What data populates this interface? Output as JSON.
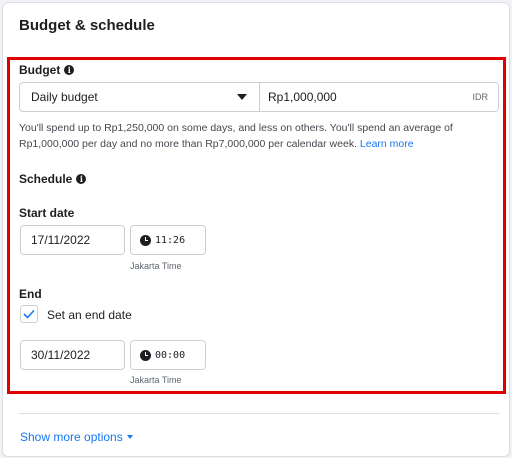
{
  "section": {
    "title": "Budget & schedule"
  },
  "budget": {
    "label": "Budget",
    "type_selected": "Daily budget",
    "amount": "Rp1,000,000",
    "currency": "IDR",
    "help_text": "You'll spend up to Rp1,250,000 on some days, and less on others. You'll spend an average of Rp1,000,000 per day and no more than Rp7,000,000 per calendar week.",
    "learn_more": "Learn more"
  },
  "schedule": {
    "label": "Schedule",
    "start": {
      "label": "Start date",
      "date": "17/11/2022",
      "time": "11:26",
      "timezone": "Jakarta Time"
    },
    "end": {
      "label": "End",
      "checkbox_label": "Set an end date",
      "checked": true,
      "date": "30/11/2022",
      "time": "00:00",
      "timezone": "Jakarta Time"
    }
  },
  "footer": {
    "show_more": "Show more options"
  },
  "colors": {
    "highlight": "#e00000",
    "link": "#1877f2",
    "check": "#1877f2"
  }
}
